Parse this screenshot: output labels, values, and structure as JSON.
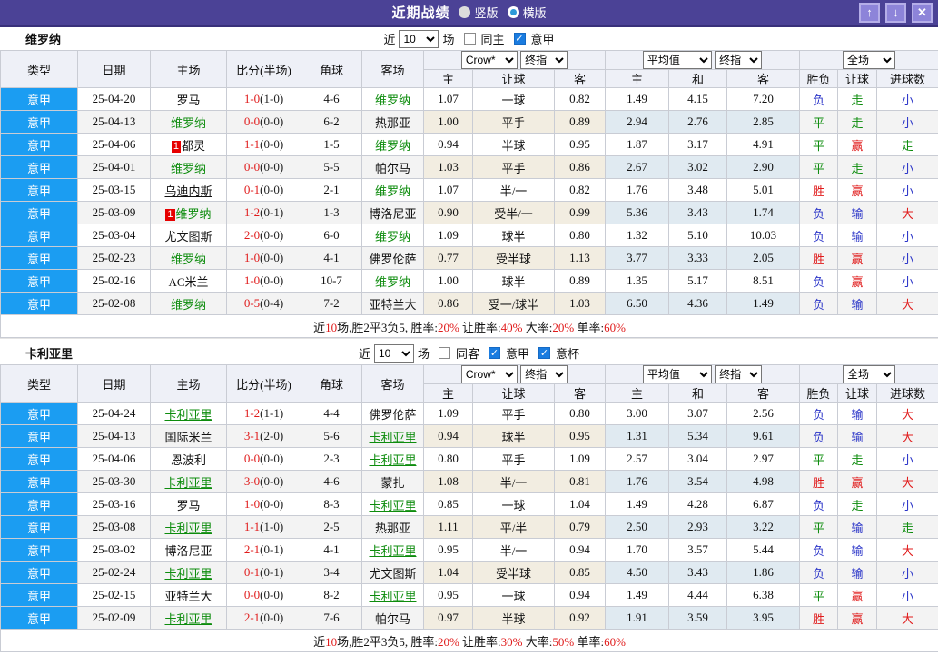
{
  "titlebar": {
    "title": "近期战绩",
    "radios": [
      {
        "label": "竖版",
        "style": "solid",
        "selected": false
      },
      {
        "label": "横版",
        "style": "ring",
        "selected": true
      }
    ],
    "buttons": [
      {
        "name": "up",
        "glyph": "↑"
      },
      {
        "name": "down",
        "glyph": "↓"
      },
      {
        "name": "close",
        "glyph": "✕"
      }
    ]
  },
  "colors": {
    "titlebar_purple": "#4b4296",
    "league_cell_blue": "#1b9df2",
    "team_green": "#0d8c0d",
    "win_red": "#e01b1b",
    "loss_blue": "#2b35c8"
  },
  "main_headers": [
    "类型",
    "日期",
    "主场",
    "比分(半场)",
    "角球",
    "客场"
  ],
  "sub_headers": [
    "主",
    "让球",
    "客",
    "主",
    "和",
    "客",
    "胜负",
    "让球",
    "进球数"
  ],
  "dropdowns": [
    "Crow*",
    "终指",
    "平均值",
    "终指",
    "全场"
  ],
  "tables": [
    {
      "team": "维罗纳",
      "controls": {
        "near": "近",
        "count": "10",
        "games": "场",
        "checks": [
          {
            "label": "同主",
            "on": false
          },
          {
            "label": "意甲",
            "on": true
          }
        ]
      },
      "rows": [
        {
          "lg": "意甲",
          "date": "25-04-20",
          "home": {
            "n": "罗马",
            "c": "k"
          },
          "s": "1-0",
          "h": "(1-0)",
          "cn": "4-6",
          "away": {
            "n": "维罗纳",
            "c": "g"
          },
          "o": [
            "1.07",
            "一球",
            "0.82"
          ],
          "avg": [
            "1.49",
            "4.15",
            "7.20"
          ],
          "res": [
            [
              "负",
              "b"
            ],
            [
              "走",
              "g"
            ],
            [
              "小",
              "b"
            ]
          ]
        },
        {
          "lg": "意甲",
          "date": "25-04-13",
          "home": {
            "n": "维罗纳",
            "c": "g"
          },
          "s": "0-0",
          "h": "(0-0)",
          "cn": "6-2",
          "away": {
            "n": "热那亚",
            "c": "k"
          },
          "o": [
            "1.00",
            "平手",
            "0.89"
          ],
          "avg": [
            "2.94",
            "2.76",
            "2.85"
          ],
          "res": [
            [
              "平",
              "g"
            ],
            [
              "走",
              "g"
            ],
            [
              "小",
              "b"
            ]
          ]
        },
        {
          "lg": "意甲",
          "date": "25-04-06",
          "home": {
            "n": "都灵",
            "c": "k",
            "bd": "1"
          },
          "s": "1-1",
          "h": "(0-0)",
          "cn": "1-5",
          "away": {
            "n": "维罗纳",
            "c": "g"
          },
          "o": [
            "0.94",
            "半球",
            "0.95"
          ],
          "avg": [
            "1.87",
            "3.17",
            "4.91"
          ],
          "res": [
            [
              "平",
              "g"
            ],
            [
              "赢",
              "r"
            ],
            [
              "走",
              "g"
            ]
          ]
        },
        {
          "lg": "意甲",
          "date": "25-04-01",
          "home": {
            "n": "维罗纳",
            "c": "g"
          },
          "s": "0-0",
          "h": "(0-0)",
          "cn": "5-5",
          "away": {
            "n": "帕尔马",
            "c": "k"
          },
          "o": [
            "1.03",
            "平手",
            "0.86"
          ],
          "avg": [
            "2.67",
            "3.02",
            "2.90"
          ],
          "res": [
            [
              "平",
              "g"
            ],
            [
              "走",
              "g"
            ],
            [
              "小",
              "b"
            ]
          ]
        },
        {
          "lg": "意甲",
          "date": "25-03-15",
          "home": {
            "n": "乌迪内斯",
            "c": "k",
            "u": true
          },
          "s": "0-1",
          "h": "(0-0)",
          "cn": "2-1",
          "away": {
            "n": "维罗纳",
            "c": "g"
          },
          "o": [
            "1.07",
            "半/一",
            "0.82"
          ],
          "avg": [
            "1.76",
            "3.48",
            "5.01"
          ],
          "res": [
            [
              "胜",
              "r"
            ],
            [
              "赢",
              "r"
            ],
            [
              "小",
              "b"
            ]
          ]
        },
        {
          "lg": "意甲",
          "date": "25-03-09",
          "home": {
            "n": "维罗纳",
            "c": "g",
            "bd": "1"
          },
          "s": "1-2",
          "h": "(0-1)",
          "cn": "1-3",
          "away": {
            "n": "博洛尼亚",
            "c": "k"
          },
          "o": [
            "0.90",
            "受半/一",
            "0.99"
          ],
          "avg": [
            "5.36",
            "3.43",
            "1.74"
          ],
          "res": [
            [
              "负",
              "b"
            ],
            [
              "输",
              "b"
            ],
            [
              "大",
              "r"
            ]
          ]
        },
        {
          "lg": "意甲",
          "date": "25-03-04",
          "home": {
            "n": "尤文图斯",
            "c": "k"
          },
          "s": "2-0",
          "h": "(0-0)",
          "cn": "6-0",
          "away": {
            "n": "维罗纳",
            "c": "g"
          },
          "o": [
            "1.09",
            "球半",
            "0.80"
          ],
          "avg": [
            "1.32",
            "5.10",
            "10.03"
          ],
          "res": [
            [
              "负",
              "b"
            ],
            [
              "输",
              "b"
            ],
            [
              "小",
              "b"
            ]
          ]
        },
        {
          "lg": "意甲",
          "date": "25-02-23",
          "home": {
            "n": "维罗纳",
            "c": "g"
          },
          "s": "1-0",
          "h": "(0-0)",
          "cn": "4-1",
          "away": {
            "n": "佛罗伦萨",
            "c": "k"
          },
          "o": [
            "0.77",
            "受半球",
            "1.13"
          ],
          "avg": [
            "3.77",
            "3.33",
            "2.05"
          ],
          "res": [
            [
              "胜",
              "r"
            ],
            [
              "赢",
              "r"
            ],
            [
              "小",
              "b"
            ]
          ]
        },
        {
          "lg": "意甲",
          "date": "25-02-16",
          "home": {
            "n": "AC米兰",
            "c": "k"
          },
          "s": "1-0",
          "h": "(0-0)",
          "cn": "10-7",
          "away": {
            "n": "维罗纳",
            "c": "g"
          },
          "o": [
            "1.00",
            "球半",
            "0.89"
          ],
          "avg": [
            "1.35",
            "5.17",
            "8.51"
          ],
          "res": [
            [
              "负",
              "b"
            ],
            [
              "赢",
              "r"
            ],
            [
              "小",
              "b"
            ]
          ]
        },
        {
          "lg": "意甲",
          "date": "25-02-08",
          "home": {
            "n": "维罗纳",
            "c": "g"
          },
          "s": "0-5",
          "h": "(0-4)",
          "cn": "7-2",
          "away": {
            "n": "亚特兰大",
            "c": "k"
          },
          "o": [
            "0.86",
            "受一/球半",
            "1.03"
          ],
          "avg": [
            "6.50",
            "4.36",
            "1.49"
          ],
          "res": [
            [
              "负",
              "b"
            ],
            [
              "输",
              "b"
            ],
            [
              "大",
              "r"
            ]
          ]
        }
      ],
      "summary": [
        [
          "近",
          "k"
        ],
        [
          "10",
          "r"
        ],
        [
          "场,胜2平3负5, 胜率:",
          "k"
        ],
        [
          "20%",
          "r"
        ],
        [
          " 让胜率:",
          "k"
        ],
        [
          "40%",
          "r"
        ],
        [
          " 大率:",
          "k"
        ],
        [
          "20%",
          "r"
        ],
        [
          " 单率:",
          "k"
        ],
        [
          "60%",
          "r"
        ]
      ]
    },
    {
      "team": "卡利亚里",
      "controls": {
        "near": "近",
        "count": "10",
        "games": "场",
        "checks": [
          {
            "label": "同客",
            "on": false
          },
          {
            "label": "意甲",
            "on": true
          },
          {
            "label": "意杯",
            "on": true
          }
        ]
      },
      "rows": [
        {
          "lg": "意甲",
          "date": "25-04-24",
          "home": {
            "n": "卡利亚里",
            "c": "g",
            "u": true
          },
          "s": "1-2",
          "h": "(1-1)",
          "cn": "4-4",
          "away": {
            "n": "佛罗伦萨",
            "c": "k"
          },
          "o": [
            "1.09",
            "平手",
            "0.80"
          ],
          "avg": [
            "3.00",
            "3.07",
            "2.56"
          ],
          "res": [
            [
              "负",
              "b"
            ],
            [
              "输",
              "b"
            ],
            [
              "大",
              "r"
            ]
          ]
        },
        {
          "lg": "意甲",
          "date": "25-04-13",
          "home": {
            "n": "国际米兰",
            "c": "k"
          },
          "s": "3-1",
          "h": "(2-0)",
          "cn": "5-6",
          "away": {
            "n": "卡利亚里",
            "c": "g",
            "u": true
          },
          "o": [
            "0.94",
            "球半",
            "0.95"
          ],
          "avg": [
            "1.31",
            "5.34",
            "9.61"
          ],
          "res": [
            [
              "负",
              "b"
            ],
            [
              "输",
              "b"
            ],
            [
              "大",
              "r"
            ]
          ]
        },
        {
          "lg": "意甲",
          "date": "25-04-06",
          "home": {
            "n": "恩波利",
            "c": "k"
          },
          "s": "0-0",
          "h": "(0-0)",
          "cn": "2-3",
          "away": {
            "n": "卡利亚里",
            "c": "g",
            "u": true
          },
          "o": [
            "0.80",
            "平手",
            "1.09"
          ],
          "avg": [
            "2.57",
            "3.04",
            "2.97"
          ],
          "res": [
            [
              "平",
              "g"
            ],
            [
              "走",
              "g"
            ],
            [
              "小",
              "b"
            ]
          ]
        },
        {
          "lg": "意甲",
          "date": "25-03-30",
          "home": {
            "n": "卡利亚里",
            "c": "g",
            "u": true
          },
          "s": "3-0",
          "h": "(0-0)",
          "cn": "4-6",
          "away": {
            "n": "蒙扎",
            "c": "k"
          },
          "o": [
            "1.08",
            "半/一",
            "0.81"
          ],
          "avg": [
            "1.76",
            "3.54",
            "4.98"
          ],
          "res": [
            [
              "胜",
              "r"
            ],
            [
              "赢",
              "r"
            ],
            [
              "大",
              "r"
            ]
          ]
        },
        {
          "lg": "意甲",
          "date": "25-03-16",
          "home": {
            "n": "罗马",
            "c": "k"
          },
          "s": "1-0",
          "h": "(0-0)",
          "cn": "8-3",
          "away": {
            "n": "卡利亚里",
            "c": "g",
            "u": true
          },
          "o": [
            "0.85",
            "一球",
            "1.04"
          ],
          "avg": [
            "1.49",
            "4.28",
            "6.87"
          ],
          "res": [
            [
              "负",
              "b"
            ],
            [
              "走",
              "g"
            ],
            [
              "小",
              "b"
            ]
          ]
        },
        {
          "lg": "意甲",
          "date": "25-03-08",
          "home": {
            "n": "卡利亚里",
            "c": "g",
            "u": true
          },
          "s": "1-1",
          "h": "(1-0)",
          "cn": "2-5",
          "away": {
            "n": "热那亚",
            "c": "k"
          },
          "o": [
            "1.11",
            "平/半",
            "0.79"
          ],
          "avg": [
            "2.50",
            "2.93",
            "3.22"
          ],
          "res": [
            [
              "平",
              "g"
            ],
            [
              "输",
              "b"
            ],
            [
              "走",
              "g"
            ]
          ]
        },
        {
          "lg": "意甲",
          "date": "25-03-02",
          "home": {
            "n": "博洛尼亚",
            "c": "k"
          },
          "s": "2-1",
          "h": "(0-1)",
          "cn": "4-1",
          "away": {
            "n": "卡利亚里",
            "c": "g",
            "u": true
          },
          "o": [
            "0.95",
            "半/一",
            "0.94"
          ],
          "avg": [
            "1.70",
            "3.57",
            "5.44"
          ],
          "res": [
            [
              "负",
              "b"
            ],
            [
              "输",
              "b"
            ],
            [
              "大",
              "r"
            ]
          ]
        },
        {
          "lg": "意甲",
          "date": "25-02-24",
          "home": {
            "n": "卡利亚里",
            "c": "g",
            "u": true
          },
          "s": "0-1",
          "h": "(0-1)",
          "cn": "3-4",
          "away": {
            "n": "尤文图斯",
            "c": "k"
          },
          "o": [
            "1.04",
            "受半球",
            "0.85"
          ],
          "avg": [
            "4.50",
            "3.43",
            "1.86"
          ],
          "res": [
            [
              "负",
              "b"
            ],
            [
              "输",
              "b"
            ],
            [
              "小",
              "b"
            ]
          ]
        },
        {
          "lg": "意甲",
          "date": "25-02-15",
          "home": {
            "n": "亚特兰大",
            "c": "k"
          },
          "s": "0-0",
          "h": "(0-0)",
          "cn": "8-2",
          "away": {
            "n": "卡利亚里",
            "c": "g",
            "u": true
          },
          "o": [
            "0.95",
            "一球",
            "0.94"
          ],
          "avg": [
            "1.49",
            "4.44",
            "6.38"
          ],
          "res": [
            [
              "平",
              "g"
            ],
            [
              "赢",
              "r"
            ],
            [
              "小",
              "b"
            ]
          ]
        },
        {
          "lg": "意甲",
          "date": "25-02-09",
          "home": {
            "n": "卡利亚里",
            "c": "g",
            "u": true
          },
          "s": "2-1",
          "h": "(0-0)",
          "cn": "7-6",
          "away": {
            "n": "帕尔马",
            "c": "k"
          },
          "o": [
            "0.97",
            "半球",
            "0.92"
          ],
          "avg": [
            "1.91",
            "3.59",
            "3.95"
          ],
          "res": [
            [
              "胜",
              "r"
            ],
            [
              "赢",
              "r"
            ],
            [
              "大",
              "r"
            ]
          ]
        }
      ],
      "summary": [
        [
          "近",
          "k"
        ],
        [
          "10",
          "r"
        ],
        [
          "场,胜2平3负5, 胜率:",
          "k"
        ],
        [
          "20%",
          "r"
        ],
        [
          " 让胜率:",
          "k"
        ],
        [
          "30%",
          "r"
        ],
        [
          " 大率:",
          "k"
        ],
        [
          "50%",
          "r"
        ],
        [
          " 单率:",
          "k"
        ],
        [
          "60%",
          "r"
        ]
      ]
    }
  ]
}
